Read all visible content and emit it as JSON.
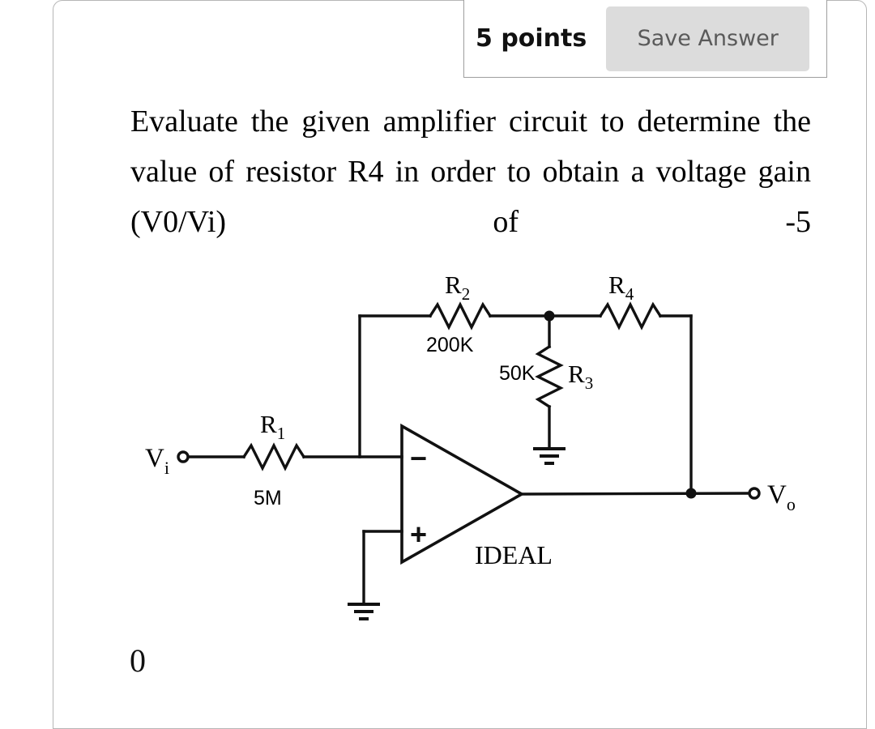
{
  "header": {
    "points_label": "5 points",
    "save_button_label": "Save Answer"
  },
  "question": {
    "prompt": "Evaluate the given amplifier circuit to determine the value of resistor R4 in order to obtain a voltage gain (V0/Vi) of -5",
    "answer_value": "0"
  },
  "circuit": {
    "caption": "IDEAL",
    "input_terminal_label": "Vi",
    "output_terminal_label": "Vo",
    "opamp_inverting_label": "−",
    "opamp_noninverting_label": "+",
    "components": [
      {
        "ref": "R1",
        "ref_base": "R",
        "ref_sub": "1",
        "value": "5M"
      },
      {
        "ref": "R2",
        "ref_base": "R",
        "ref_sub": "2",
        "value": "200K"
      },
      {
        "ref": "R3",
        "ref_base": "R",
        "ref_sub": "3",
        "value": "50K"
      },
      {
        "ref": "R4",
        "ref_base": "R",
        "ref_sub": "4",
        "value": ""
      }
    ],
    "colors": {
      "wire": "#111111",
      "label": "#000000"
    }
  }
}
